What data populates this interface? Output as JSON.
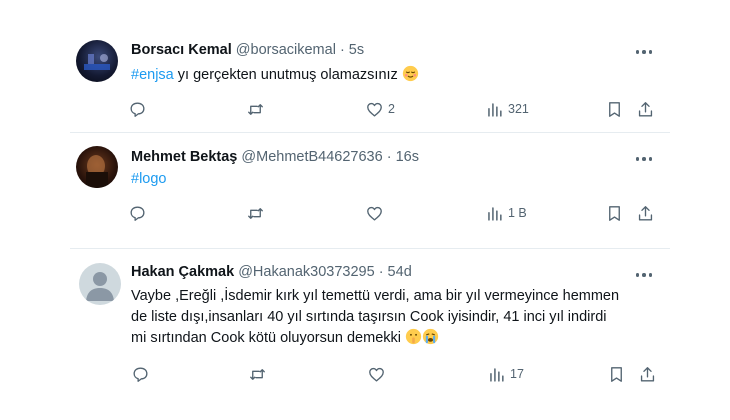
{
  "tweets": [
    {
      "name": "Borsacı Kemal",
      "handle": "@borsacikemal",
      "time": "· 5s",
      "hashtag": "#enjsa",
      "text": " yı gerçekten unutmuş olamazsınız",
      "replies": "",
      "retweets": "",
      "likes": "2",
      "views": "321"
    },
    {
      "name": "Mehmet Bektaş",
      "handle": "@MehmetB44627636",
      "time": "· 16s",
      "hashtag": "#logo",
      "text": "",
      "replies": "",
      "retweets": "",
      "likes": "",
      "views": "1 B"
    },
    {
      "name": "Hakan Çakmak",
      "handle": "@Hakanak30373295",
      "time": "· 54d",
      "lines": [
        "Vaybe ,Ereğli ,İsdemir kırk yıl temettü verdi, ama bir yıl vermeyince hemmen",
        "de liste dışı,insanları 40 yıl sırtında taşırsın Cook iyisindir, 41 inci yıl indirdi",
        "mi sırtından Cook kötü oluyorsun demekki"
      ],
      "replies": "",
      "retweets": "",
      "likes": "",
      "views": "17"
    }
  ],
  "colors": {
    "accent": "#1d9bf0",
    "text": "#0f1419",
    "muted": "#536471",
    "divider": "#e6ecf0"
  },
  "icons": [
    "reply-icon",
    "retweet-icon",
    "like-icon",
    "views-icon",
    "bookmark-icon",
    "share-icon",
    "more-icon"
  ]
}
